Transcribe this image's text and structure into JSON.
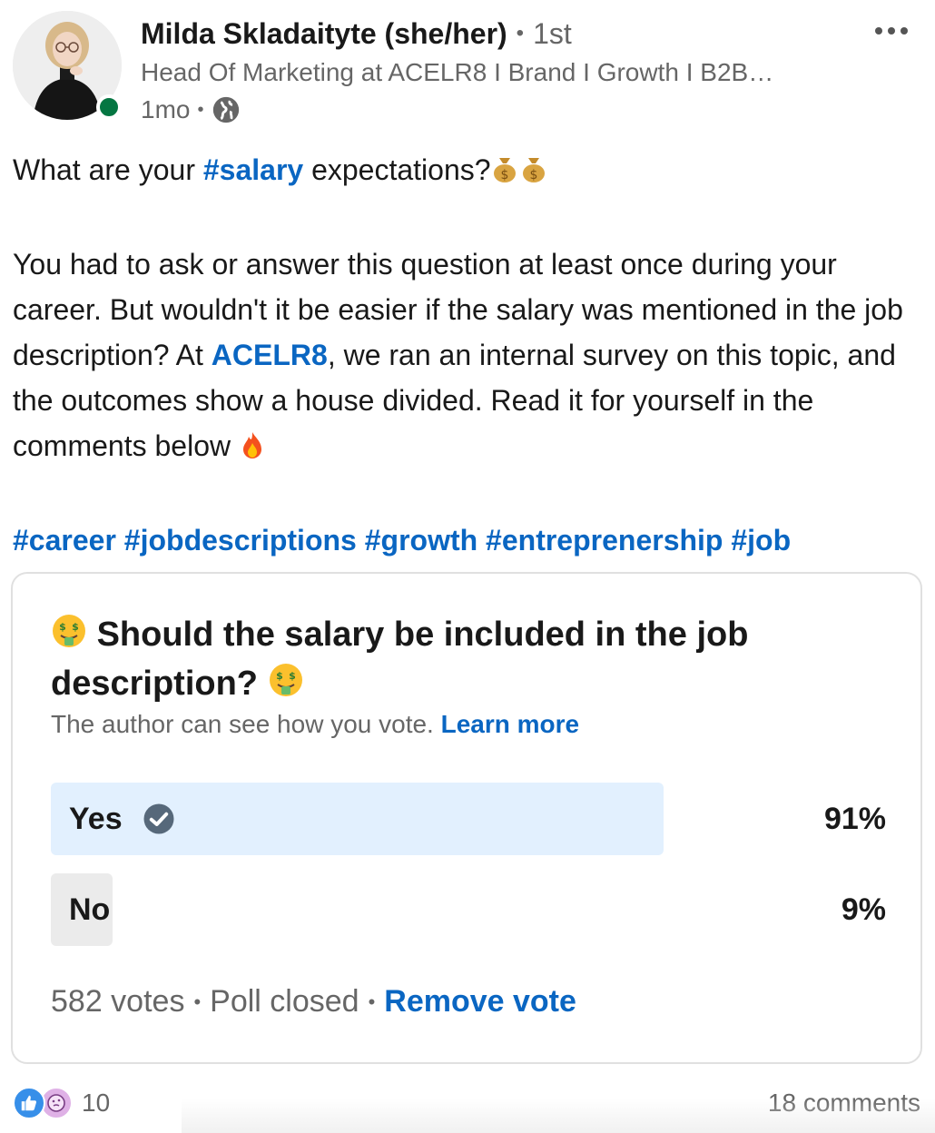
{
  "author": {
    "name": "Milda Skladaityte (she/her)",
    "degree": "1st",
    "headline": "Head Of Marketing at ACELR8 I Brand I Growth I B2B…",
    "time": "1mo",
    "online": true,
    "visibility_icon": "globe-icon",
    "presence_color": "#057642"
  },
  "menu": {
    "icon": "more-horizontal-icon"
  },
  "post": {
    "line1_prefix": "What are your ",
    "line1_hashtag": "#salary",
    "line1_suffix": " expectations?",
    "para2_a": "You had to ask or answer this question at least once during your career. But wouldn't it be easier if the salary was mentioned in the job description? At ",
    "para2_mention": "ACELR8",
    "para2_b": ", we ran an internal survey on this topic, and the outcomes show a house divided. Read it for yourself in the comments below ",
    "hashtags": [
      "#career",
      "#jobdescriptions",
      "#growth",
      "#entreprenership",
      "#job"
    ],
    "emojis": [
      "money-bag-emoji",
      "money-bag-emoji",
      "fire-emoji"
    ]
  },
  "poll": {
    "question": "Should the salary be included in the job description?",
    "question_emoji": "money-mouth-face-emoji",
    "note": "The author can see how you vote.",
    "learn_more": "Learn more",
    "options": [
      {
        "label": "Yes",
        "percent_label": "91%",
        "share": 0.91,
        "selected": true,
        "fill_color": "#e2f0fe"
      },
      {
        "label": "No",
        "percent_label": "9%",
        "share": 0.09,
        "selected": false,
        "fill_color": "#ebebeb"
      }
    ],
    "votes": "582 votes",
    "status": "Poll closed",
    "remove_vote": "Remove vote"
  },
  "social": {
    "reaction_count": "10",
    "comments": "18 comments",
    "reaction_icons": [
      "like-icon",
      "curious-icon"
    ]
  },
  "colors": {
    "link": "#0a66c2",
    "text": "#191919",
    "muted": "#666666",
    "border": "#e0e0e0"
  }
}
